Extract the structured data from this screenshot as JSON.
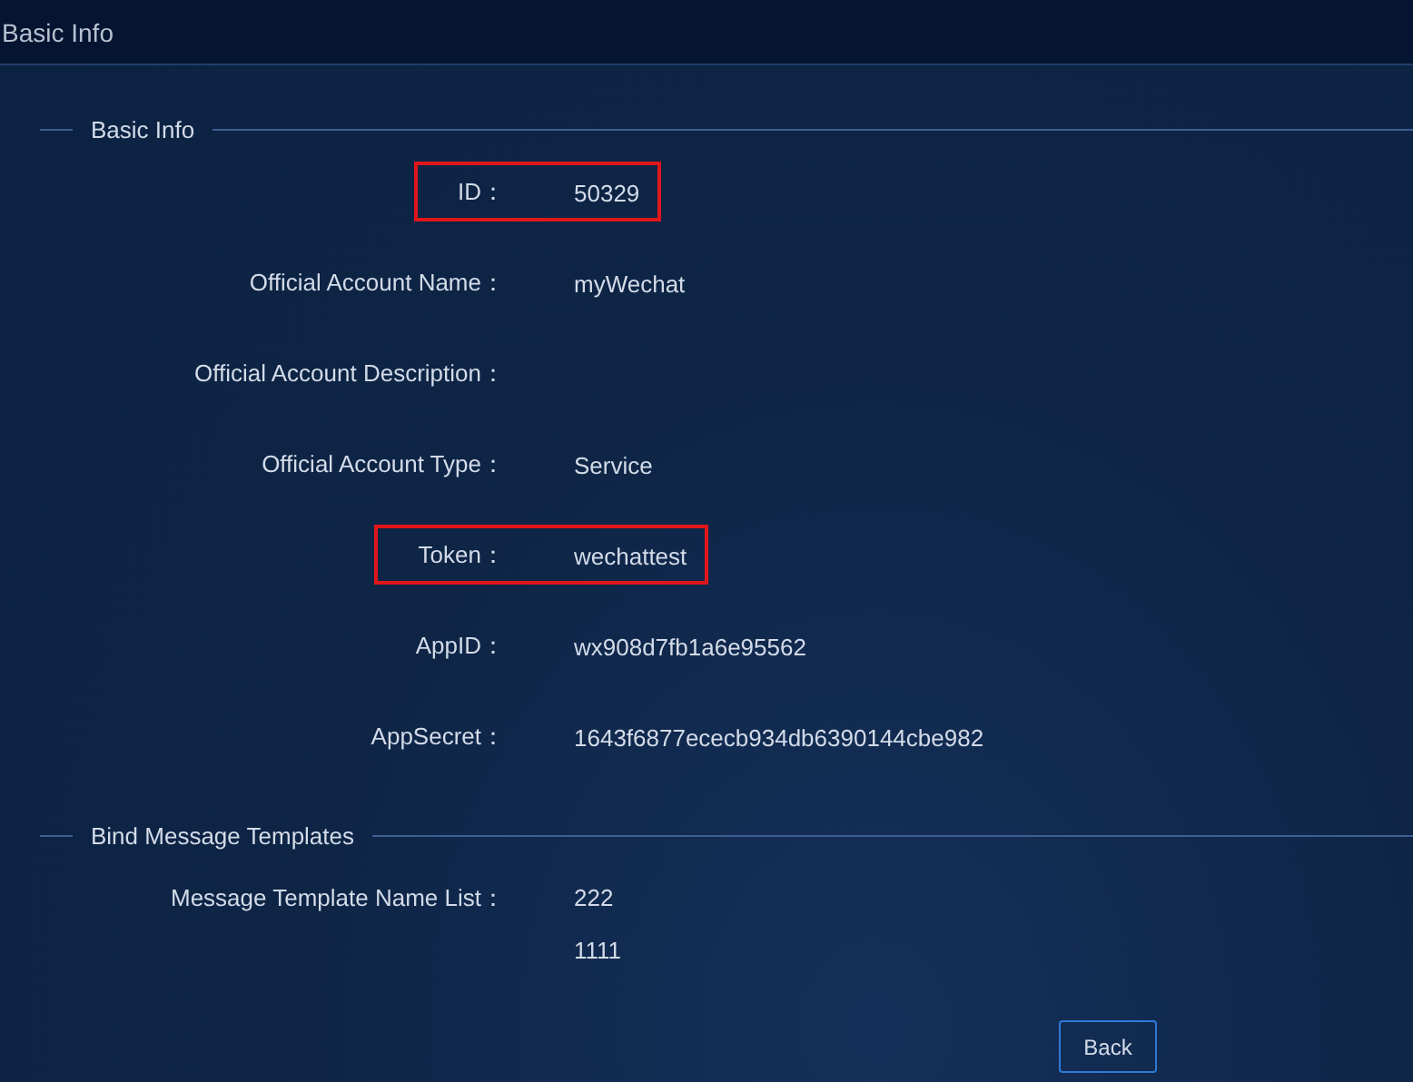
{
  "header": {
    "title": "Basic Info"
  },
  "sections": [
    {
      "legend": "Basic Info",
      "rows": [
        {
          "label": "ID：",
          "values": [
            "50329"
          ],
          "highlighted": true
        },
        {
          "label": "Official Account Name：",
          "values": [
            "myWechat"
          ],
          "highlighted": false
        },
        {
          "label": "Official Account Description：",
          "values": [],
          "highlighted": false
        },
        {
          "label": "Official Account Type：",
          "values": [
            "Service"
          ],
          "highlighted": false
        },
        {
          "label": "Token：",
          "values": [
            "wechattest"
          ],
          "highlighted": true
        },
        {
          "label": "AppID：",
          "values": [
            "wx908d7fb1a6e95562"
          ],
          "highlighted": false
        },
        {
          "label": "AppSecret：",
          "values": [
            "1643f6877ececb934db6390144cbe982"
          ],
          "highlighted": false
        }
      ]
    },
    {
      "legend": "Bind Message Templates",
      "rows": [
        {
          "label": "Message Template Name List：",
          "values": [
            "222",
            "1111"
          ],
          "highlighted": false
        }
      ]
    }
  ],
  "buttons": [
    {
      "label": "Back"
    }
  ]
}
